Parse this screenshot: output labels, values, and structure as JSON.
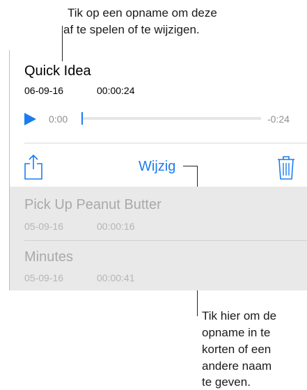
{
  "callouts": {
    "top_line1": "Tik op een opname om deze",
    "top_line2": "af te spelen of te wijzigen.",
    "bottom_lines": [
      "Tik hier om de",
      "opname in te",
      "korten of een",
      "andere naam",
      "te geven."
    ]
  },
  "selected": {
    "title": "Quick Idea",
    "date": "06-09-16",
    "duration": "00:00:24",
    "elapsed": "0:00",
    "remaining": "-0:24",
    "progress": 0
  },
  "toolbar": {
    "share_icon": "share-icon",
    "edit_label": "Wijzig",
    "trash_icon": "trash-icon"
  },
  "recordings": [
    {
      "title": "Pick Up Peanut Butter",
      "date": "05-09-16",
      "duration": "00:00:16"
    },
    {
      "title": "Minutes",
      "date": "05-09-16",
      "duration": "00:00:41"
    }
  ],
  "colors": {
    "accent": "#1a7cf0",
    "list_background": "#e9e9e9",
    "muted_text": "#a9a9a9"
  }
}
